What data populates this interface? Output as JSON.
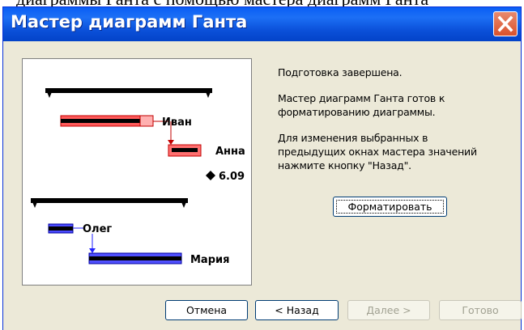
{
  "window": {
    "title": "Мастер диаграмм Ганта",
    "close_icon": "close-icon"
  },
  "preview": {
    "tasks": [
      "Иван",
      "Анна",
      "Олег",
      "Мария"
    ],
    "milestone_label": "6.09"
  },
  "message": {
    "line1": "Подготовка завершена.",
    "line2a": "Мастер диаграмм Ганта готов к",
    "line2b": "форматированию диаграммы.",
    "line3a": "Для изменения выбранных в",
    "line3b": "предыдущих окнах мастера значений",
    "line3c": "нажмите кнопку \"Назад\"."
  },
  "buttons": {
    "format": "Форматировать",
    "cancel": "Отмена",
    "back": "< Назад",
    "next": "Далее >",
    "finish": "Готово"
  },
  "colors": {
    "titlebar": "#0a4fd8",
    "task_red": "#ff5555",
    "task_blue": "#2020ff",
    "dialog_bg": "#ece9d8"
  }
}
